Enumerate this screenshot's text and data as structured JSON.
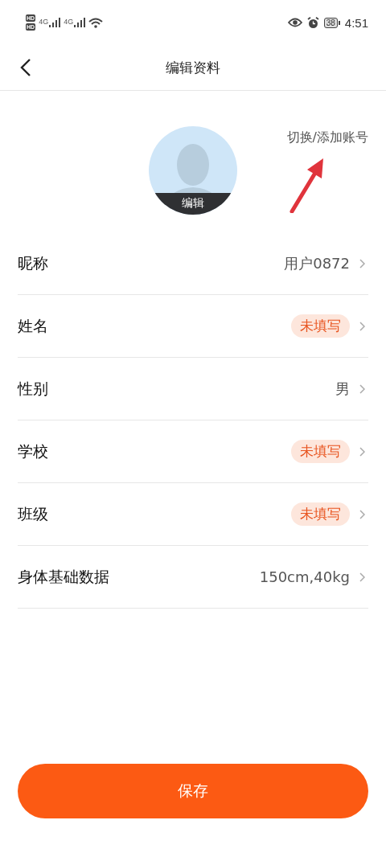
{
  "status_bar": {
    "sim_labels": [
      "HD",
      "HD"
    ],
    "network_labels": [
      "4G",
      "4G"
    ],
    "battery": "38",
    "time": "4:51"
  },
  "header": {
    "title": "编辑资料"
  },
  "profile": {
    "avatar_label": "编辑",
    "switch_account": "切换/添加账号"
  },
  "rows": [
    {
      "label": "昵称",
      "kind": "value",
      "value": "用户0872"
    },
    {
      "label": "姓名",
      "kind": "tag",
      "value": "未填写"
    },
    {
      "label": "性别",
      "kind": "value",
      "value": "男"
    },
    {
      "label": "学校",
      "kind": "tag",
      "value": "未填写"
    },
    {
      "label": "班级",
      "kind": "tag",
      "value": "未填写"
    },
    {
      "label": "身体基础数据",
      "kind": "value",
      "value": "150cm,40kg"
    }
  ],
  "save_button": "保存"
}
